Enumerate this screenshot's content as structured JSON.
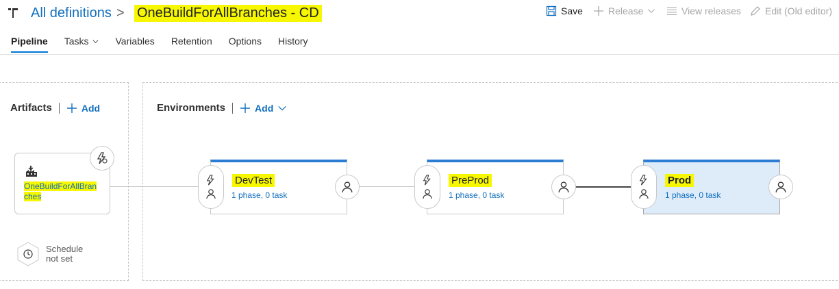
{
  "header": {
    "breadcrumb_link": "All definitions",
    "breadcrumb_sep": ">",
    "title": "OneBuildForAllBranches - CD",
    "toolbar": {
      "save": "Save",
      "release": "Release",
      "view_releases": "View releases",
      "edit_old": "Edit (Old editor)"
    }
  },
  "tabs": [
    {
      "label": "Pipeline",
      "active": true
    },
    {
      "label": "Tasks",
      "dropdown": true
    },
    {
      "label": "Variables"
    },
    {
      "label": "Retention"
    },
    {
      "label": "Options"
    },
    {
      "label": "History"
    }
  ],
  "artifacts": {
    "title": "Artifacts",
    "add_label": "Add",
    "item": {
      "name": "OneBuildForAllBranches",
      "icon": "build-factory-icon"
    },
    "schedule_line1": "Schedule",
    "schedule_line2": "not set"
  },
  "environments": {
    "title": "Environments",
    "add_label": "Add",
    "items": [
      {
        "name": "DevTest",
        "summary": "1 phase, 0 task",
        "selected": false
      },
      {
        "name": "PreProd",
        "summary": "1 phase, 0 task",
        "selected": false
      },
      {
        "name": "Prod",
        "summary": "1 phase, 0 task",
        "selected": true
      }
    ]
  },
  "colors": {
    "accent": "#2b7cd3",
    "link": "#106ebe",
    "highlight": "#f6f700",
    "selected_bg": "#deecf9"
  }
}
